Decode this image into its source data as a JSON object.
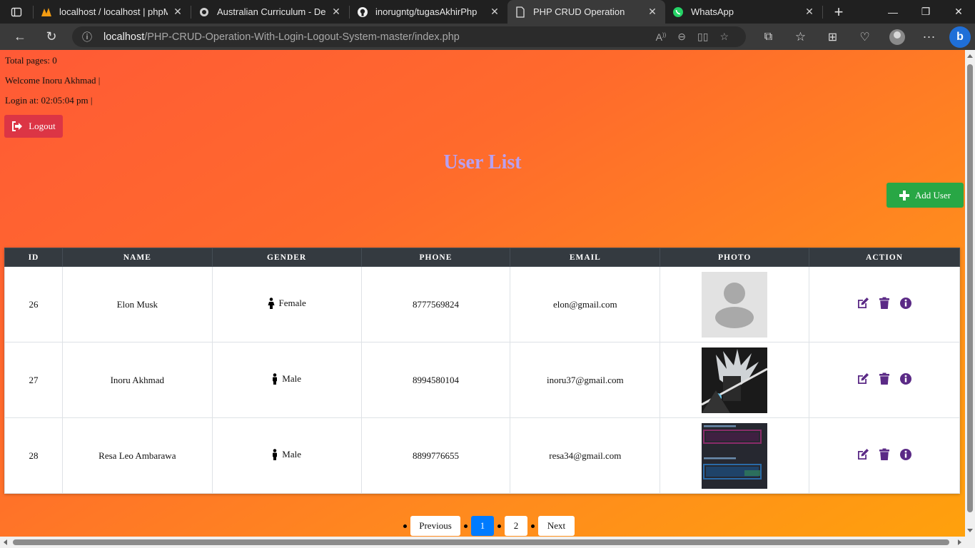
{
  "browser": {
    "tabs": [
      {
        "title": "localhost / localhost | phpMyA",
        "icon": "phpmyadmin-icon"
      },
      {
        "title": "Australian Curriculum - Depar",
        "icon": "crest-icon"
      },
      {
        "title": "inorugntg/tugasAkhirPhp",
        "icon": "github-icon"
      },
      {
        "title": "PHP CRUD Operation",
        "icon": "document-icon",
        "active": true
      },
      {
        "title": "WhatsApp",
        "icon": "whatsapp-icon"
      }
    ],
    "url_host": "localhost",
    "url_path": "/PHP-CRUD-Operation-With-Login-Logout-System-master/index.php"
  },
  "page": {
    "total_pages": "Total pages: 0",
    "welcome": "Welcome Inoru Akhmad |",
    "login_at": "Login at: 02:05:04 pm |",
    "logout_label": "Logout",
    "title": "User List",
    "add_user_label": "Add User"
  },
  "table": {
    "headers": [
      "ID",
      "NAME",
      "GENDER",
      "PHONE",
      "EMAIL",
      "PHOTO",
      "ACTION"
    ],
    "rows": [
      {
        "id": "26",
        "name": "Elon Musk",
        "gender": "Female",
        "phone": "8777569824",
        "email": "elon@gmail.com",
        "photo": "default-avatar"
      },
      {
        "id": "27",
        "name": "Inoru Akhmad",
        "gender": "Male",
        "phone": "8994580104",
        "email": "inoru37@gmail.com",
        "photo": "anime-character"
      },
      {
        "id": "28",
        "name": "Resa Leo Ambarawa",
        "gender": "Male",
        "phone": "8899776655",
        "email": "resa34@gmail.com",
        "photo": "welcome-terminal"
      }
    ]
  },
  "pagination": {
    "previous": "Previous",
    "pages": [
      "1",
      "2"
    ],
    "active_page": "1",
    "next": "Next"
  },
  "colors": {
    "action_icons": "#5b2a86",
    "logout": "#dc3545",
    "add_user": "#28a745",
    "title": "#b8a0f0",
    "active_page": "#007bff"
  }
}
